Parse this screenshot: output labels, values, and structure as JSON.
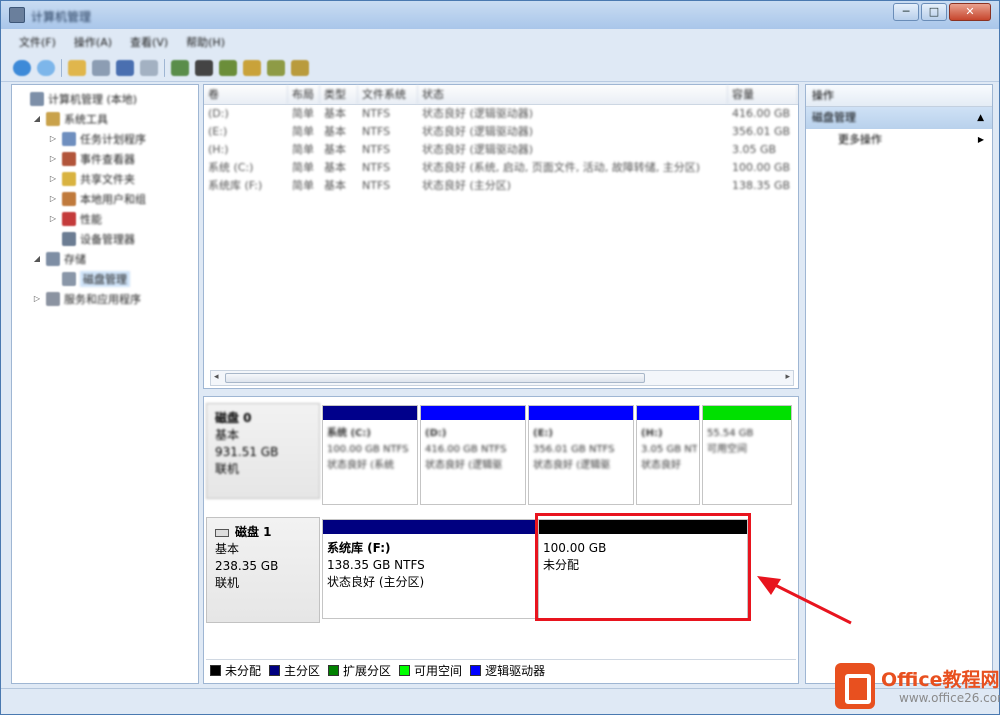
{
  "window": {
    "title": "计算机管理"
  },
  "menu": [
    "文件(F)",
    "操作(A)",
    "查看(V)",
    "帮助(H)"
  ],
  "toolbar_icons": [
    "back-icon",
    "forward-icon",
    "up-folder-icon",
    "console-tree-icon",
    "properties-icon",
    "help-icon",
    "view-icon",
    "refresh-icon",
    "delete-icon",
    "export-icon",
    "open-icon",
    "search-icon",
    "wizard-icon"
  ],
  "tree": {
    "items": [
      {
        "label": "计算机管理 (本地)",
        "level": 0,
        "expander": "",
        "icon": "computer-icon",
        "color": "#7d8fa8"
      },
      {
        "label": "系统工具",
        "level": 1,
        "expander": "◢",
        "icon": "toolbox-icon",
        "color": "#c9a24b"
      },
      {
        "label": "任务计划程序",
        "level": 2,
        "expander": "▷",
        "icon": "clock-icon",
        "color": "#6f8fbf"
      },
      {
        "label": "事件查看器",
        "level": 2,
        "expander": "▷",
        "icon": "event-viewer-icon",
        "color": "#b2553b"
      },
      {
        "label": "共享文件夹",
        "level": 2,
        "expander": "▷",
        "icon": "shared-folder-icon",
        "color": "#d9b340"
      },
      {
        "label": "本地用户和组",
        "level": 2,
        "expander": "▷",
        "icon": "users-icon",
        "color": "#c07a3c"
      },
      {
        "label": "性能",
        "level": 2,
        "expander": "▷",
        "icon": "performance-icon",
        "color": "#c43b3b"
      },
      {
        "label": "设备管理器",
        "level": 2,
        "expander": "",
        "icon": "device-manager-icon",
        "color": "#6c7d93"
      },
      {
        "label": "存储",
        "level": 1,
        "expander": "◢",
        "icon": "storage-icon",
        "color": "#7e8ea4"
      },
      {
        "label": "磁盘管理",
        "level": 2,
        "expander": "",
        "icon": "disk-management-icon",
        "color": "#8a97a8",
        "selected": true
      },
      {
        "label": "服务和应用程序",
        "level": 1,
        "expander": "▷",
        "icon": "services-icon",
        "color": "#8b93a1"
      }
    ]
  },
  "volume_list": {
    "columns": [
      "卷",
      "布局",
      "类型",
      "文件系统",
      "状态",
      "容量"
    ],
    "rows": [
      [
        "(D:)",
        "简单",
        "基本",
        "NTFS",
        "状态良好 (逻辑驱动器)",
        "416.00 GB"
      ],
      [
        "(E:)",
        "简单",
        "基本",
        "NTFS",
        "状态良好 (逻辑驱动器)",
        "356.01 GB"
      ],
      [
        "(H:)",
        "简单",
        "基本",
        "NTFS",
        "状态良好 (逻辑驱动器)",
        "3.05 GB"
      ],
      [
        "系统 (C:)",
        "简单",
        "基本",
        "NTFS",
        "状态良好 (系统, 启动, 页面文件, 活动, 故障转储, 主分区)",
        "100.00 GB"
      ],
      [
        "系统库 (F:)",
        "简单",
        "基本",
        "NTFS",
        "状态良好 (主分区)",
        "138.35 GB"
      ]
    ]
  },
  "disk0": {
    "name": "磁盘 0",
    "type": "基本",
    "size": "931.51 GB",
    "status": "联机",
    "partitions": [
      {
        "title": "系统 (C:)",
        "detail": "100.00 GB NTFS",
        "status": "状态良好 (系统",
        "bar": "#00008b"
      },
      {
        "title": "(D:)",
        "detail": "416.00 GB NTFS",
        "status": "状态良好 (逻辑驱",
        "bar": "#0000ff"
      },
      {
        "title": "(E:)",
        "detail": "356.01 GB NTFS",
        "status": "状态良好 (逻辑驱",
        "bar": "#0000ff"
      },
      {
        "title": "(H:)",
        "detail": "3.05 GB NTFS",
        "status": "状态良好",
        "bar": "#0000ff"
      },
      {
        "title": "",
        "detail": "55.54 GB",
        "status": "可用空间",
        "bar": "#00e000"
      }
    ]
  },
  "disk1": {
    "name": "磁盘 1",
    "type": "基本",
    "size": "238.35 GB",
    "status": "联机",
    "partitions": [
      {
        "title": "系统库  (F:)",
        "detail": "138.35 GB NTFS",
        "status": "状态良好 (主分区)",
        "bar": "#000080"
      },
      {
        "title": "",
        "detail": "100.00 GB",
        "status": "未分配",
        "bar": "#000000"
      }
    ]
  },
  "legend": [
    {
      "label": "未分配",
      "color": "#000000"
    },
    {
      "label": "主分区",
      "color": "#000080"
    },
    {
      "label": "扩展分区",
      "color": "#008000"
    },
    {
      "label": "可用空间",
      "color": "#00ff00"
    },
    {
      "label": "逻辑驱动器",
      "color": "#0000ff"
    }
  ],
  "actions": {
    "header": "操作",
    "group": "磁盘管理",
    "item": "更多操作"
  },
  "watermark": {
    "title": "Office教程网",
    "url": "www.office26.com"
  },
  "colors": {
    "annotation_red": "#e8141e",
    "brand_orange": "#e8501f"
  }
}
